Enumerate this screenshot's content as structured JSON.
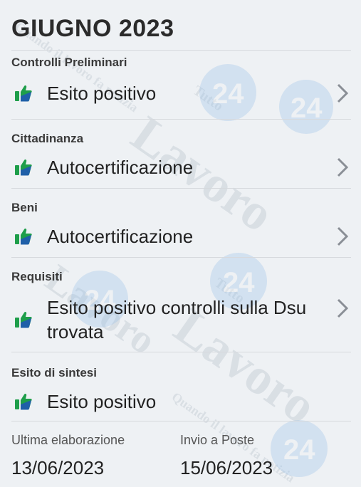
{
  "header": {
    "title": "GIUGNO 2023"
  },
  "sections": [
    {
      "label": "Controlli Preliminari",
      "value": "Esito positivo"
    },
    {
      "label": "Cittadinanza",
      "value": "Autocertificazione"
    },
    {
      "label": "Beni",
      "value": "Autocertificazione"
    },
    {
      "label": "Requisiti",
      "value": "Esito positivo controlli sulla Dsu trovata"
    },
    {
      "label": "Esito di sintesi",
      "value": "Esito positivo"
    }
  ],
  "footer": {
    "elaborazione_label": "Ultima elaborazione",
    "elaborazione_date": "13/06/2023",
    "poste_label": "Invio a Poste",
    "poste_date": "15/06/2023"
  },
  "watermark": {
    "brand_text": "Lavoro",
    "number": "24",
    "top_word": "Tutto",
    "tagline": "Quando il lavoro fa notizia"
  },
  "colors": {
    "thumb_green": "#1e9e4a",
    "thumb_blue": "#1f5fa8",
    "chevron": "#8a8f96",
    "watermark": "#c5ccd4"
  },
  "icons": {
    "status": "thumbs-up-icon",
    "navigate": "chevron-right-icon"
  }
}
